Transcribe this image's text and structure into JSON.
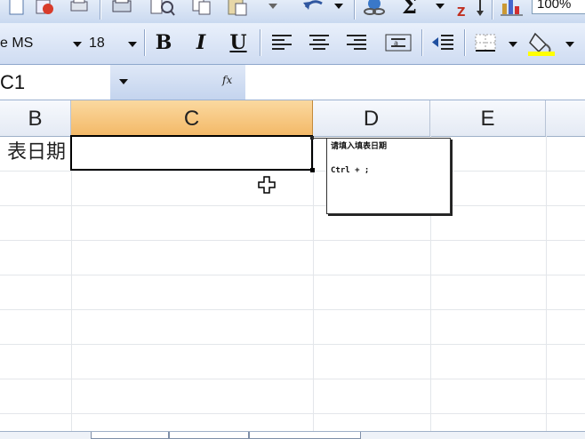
{
  "toolbar": {
    "zoom_value": "100%",
    "font_name": "e MS",
    "font_size": "18",
    "bold_label": "B",
    "italic_label": "I",
    "underline_label": "U",
    "fill_color": "#ffff00"
  },
  "formula_bar": {
    "name_box_value": "C1",
    "fx_label": "fx"
  },
  "sheet": {
    "columns": [
      "B",
      "C",
      "D",
      "E"
    ],
    "selected_column": "C",
    "cell_b1_text": "表日期",
    "comment": {
      "line1": "请填入填表日期",
      "line2": "Ctrl + ;"
    }
  },
  "colors": {
    "selected_header": "#f3b968",
    "toolbar": "#cfdcf2"
  }
}
